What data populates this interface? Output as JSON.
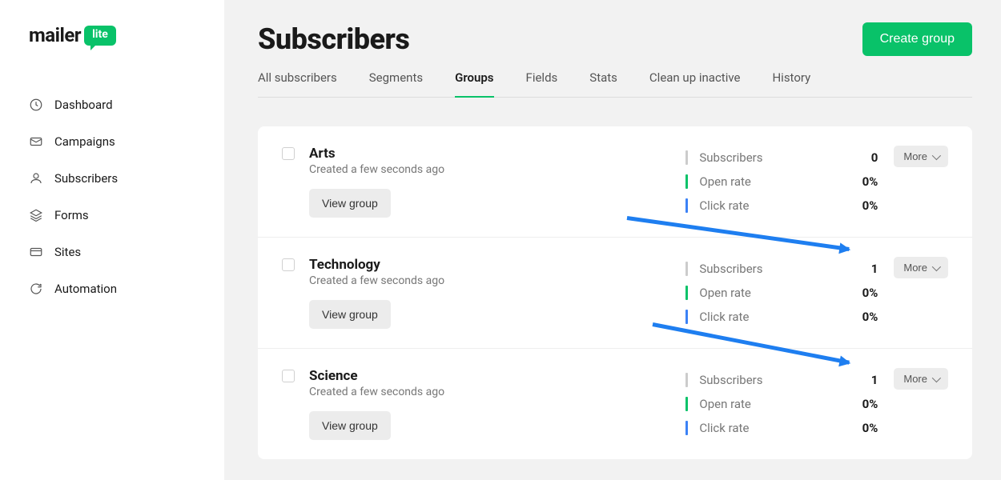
{
  "logo": {
    "word": "mailer",
    "badge": "lite"
  },
  "sidebar": {
    "items": [
      {
        "label": "Dashboard"
      },
      {
        "label": "Campaigns"
      },
      {
        "label": "Subscribers"
      },
      {
        "label": "Forms"
      },
      {
        "label": "Sites"
      },
      {
        "label": "Automation"
      }
    ]
  },
  "header": {
    "title": "Subscribers",
    "create_button": "Create group"
  },
  "tabs": {
    "items": [
      {
        "label": "All subscribers",
        "active": false
      },
      {
        "label": "Segments",
        "active": false
      },
      {
        "label": "Groups",
        "active": true
      },
      {
        "label": "Fields",
        "active": false
      },
      {
        "label": "Stats",
        "active": false
      },
      {
        "label": "Clean up inactive",
        "active": false
      },
      {
        "label": "History",
        "active": false
      }
    ]
  },
  "labels": {
    "view_group": "View group",
    "more": "More",
    "subscribers": "Subscribers",
    "open_rate": "Open rate",
    "click_rate": "Click rate"
  },
  "groups": [
    {
      "name": "Arts",
      "created": "Created a few seconds ago",
      "subscribers": "0",
      "open_rate": "0%",
      "click_rate": "0%"
    },
    {
      "name": "Technology",
      "created": "Created a few seconds ago",
      "subscribers": "1",
      "open_rate": "0%",
      "click_rate": "0%"
    },
    {
      "name": "Science",
      "created": "Created a few seconds ago",
      "subscribers": "1",
      "open_rate": "0%",
      "click_rate": "0%"
    }
  ]
}
